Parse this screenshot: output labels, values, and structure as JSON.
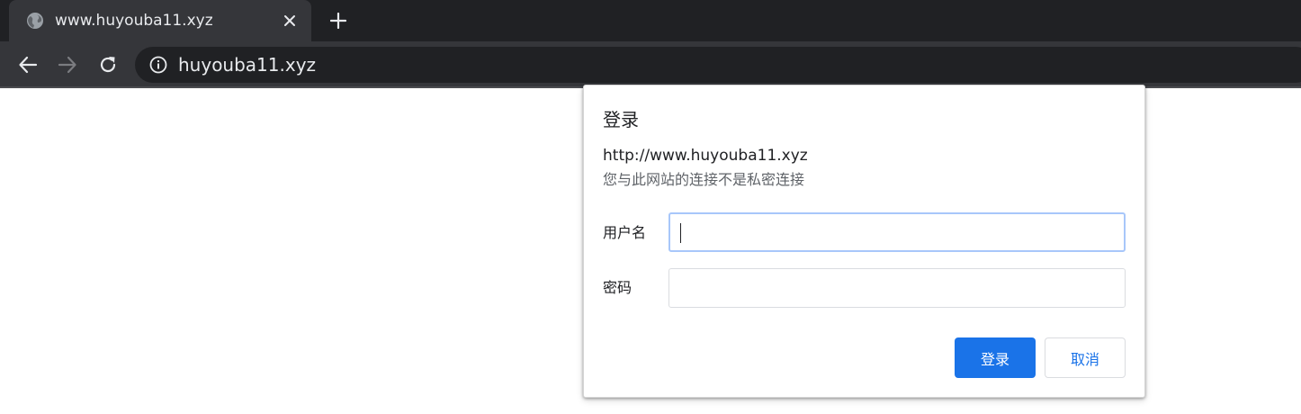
{
  "browser": {
    "tab": {
      "title": "www.huyouba11.xyz",
      "favicon": "globe-icon"
    },
    "address_bar": {
      "url": "huyouba11.xyz",
      "security_icon": "info-icon"
    }
  },
  "dialog": {
    "title": "登录",
    "origin": "http://www.huyouba11.xyz",
    "warning": "您与此网站的连接不是私密连接",
    "username_label": "用户名",
    "username_value": "",
    "password_label": "密码",
    "password_value": "",
    "login_button": "登录",
    "cancel_button": "取消"
  },
  "colors": {
    "chrome_dark": "#202124",
    "chrome_toolbar": "#35363a",
    "accent": "#1a73e8",
    "focus_ring": "#a8c7fa"
  }
}
